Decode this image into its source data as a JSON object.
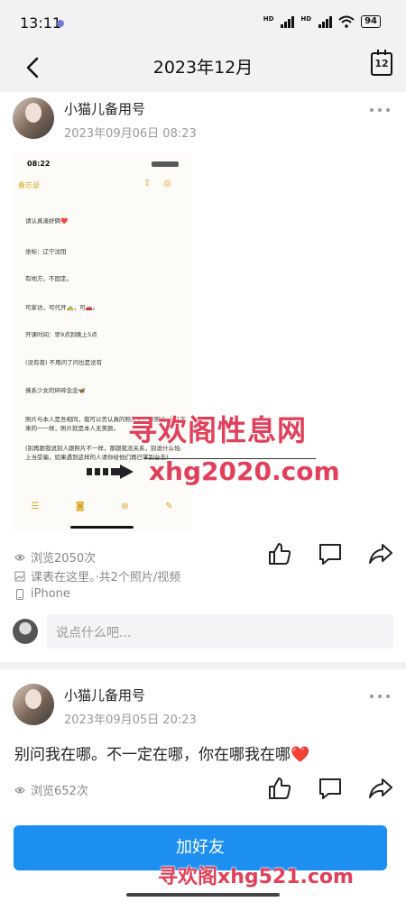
{
  "status_bar": {
    "time": "13:11",
    "battery": "94",
    "signal_label": "HD"
  },
  "header": {
    "title": "2023年12月",
    "calendar_day": "12"
  },
  "posts": [
    {
      "user": "小猫儿备用号",
      "date": "2023年09月06日 08:23",
      "photo": {
        "time": "08:22",
        "back_label": "备忘录",
        "lines": [
          "请认真凑好俩❤️",
          "坐标：辽宁沈阳",
          "有地方，不固定。",
          "可家访，可代开🚕，可🚗。",
          "开课时间：早9点到晚上5点",
          "(没有夜) 不用问了问也是没有",
          "佛系少女的碎碎念念🦋",
          "照片与本人是吾相同，我可以否认真的照片是，原照片 上扒下来的一一样，照片就是本人无美颜。",
          "(别再跟我说别人跟照片不一样，那跟我没关系，别说什么怕.上当受骗，如果遇到这样的人请你给他们再已掌别台去)"
        ]
      },
      "views": "浏览2050次",
      "location": "课表在这里。·共2个照片/视频",
      "device": "iPhone",
      "comment_placeholder": "说点什么吧..."
    },
    {
      "user": "小猫儿备用号",
      "date": "2023年09月05日 20:23",
      "text": "别问我在哪。不一定在哪，你在哪我在哪❤️",
      "views": "浏览652次"
    }
  ],
  "watermarks": {
    "site_name": "寻欢阁性息网",
    "domain": "xhg2020.com",
    "bottom": "寻欢阁xhg521.com"
  },
  "footer": {
    "add_friend_label": "加好友"
  },
  "colors": {
    "accent": "#1d8ff2",
    "watermark": "#e0405a",
    "memo_yellow": "#d9a520"
  }
}
